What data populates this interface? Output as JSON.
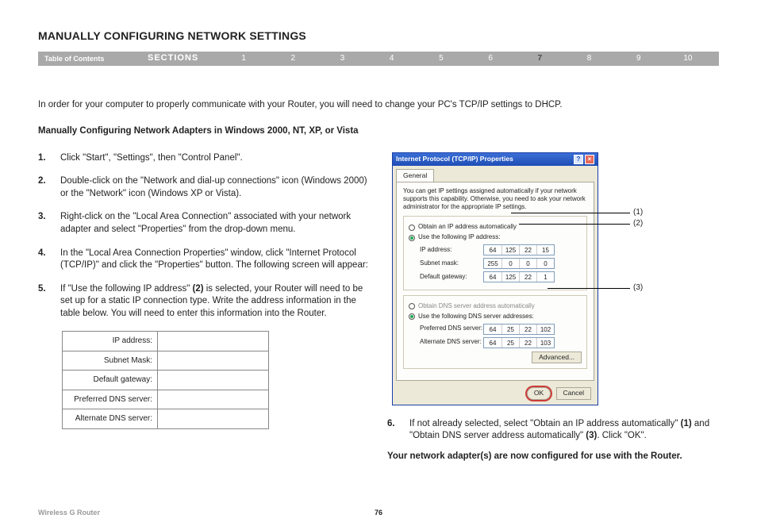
{
  "title": "MANUALLY CONFIGURING NETWORK SETTINGS",
  "nav": {
    "toc": "Table of Contents",
    "sections": "SECTIONS",
    "items": [
      "1",
      "2",
      "3",
      "4",
      "5",
      "6",
      "7",
      "8",
      "9",
      "10"
    ],
    "active": 6
  },
  "intro": "In order for your computer to properly communicate with your Router, you will need to change your PC's TCP/IP settings to DHCP.",
  "subhead": "Manually Configuring Network Adapters in Windows 2000, NT, XP, or Vista",
  "steps": {
    "s1": "Click \"Start\", \"Settings\", then \"Control Panel\".",
    "s2": "Double-click on the \"Network and dial-up connections\" icon (Windows 2000) or the \"Network\" icon (Windows XP or Vista).",
    "s3": "Right-click on the \"Local Area Connection\" associated with your network adapter and select \"Properties\" from the drop-down menu.",
    "s4": "In the \"Local Area Connection Properties\" window, click \"Internet Protocol (TCP/IP)\" and click the \"Properties\" button. The following screen will appear:",
    "s5a": "If \"Use the following IP address\" ",
    "s5b": "(2)",
    "s5c": " is selected, your Router will need to be set up for a static IP connection type. Write the address information in the table below. You will need to enter this information into the Router.",
    "s6a": "If not already selected, select \"Obtain an IP address automatically\" ",
    "s6b": "(1)",
    "s6c": " and \"Obtain DNS server address automatically\" ",
    "s6d": "(3)",
    "s6e": ". Click \"OK\"."
  },
  "blank_rows": [
    "IP address:",
    "Subnet Mask:",
    "Default gateway:",
    "Preferred DNS server:",
    "Alternate DNS server:"
  ],
  "dlg": {
    "title": "Internet Protocol (TCP/IP) Properties",
    "tab": "General",
    "desc": "You can get IP settings assigned automatically if your network supports this capability. Otherwise, you need to ask your network administrator for the appropriate IP settings.",
    "r1": "Obtain an IP address automatically",
    "r2": "Use the following IP address:",
    "f_ip": "IP address:",
    "v_ip": [
      "64",
      "125",
      "22",
      "15"
    ],
    "f_sm": "Subnet mask:",
    "v_sm": [
      "255",
      "0",
      "0",
      "0"
    ],
    "f_gw": "Default gateway:",
    "v_gw": [
      "64",
      "125",
      "22",
      "1"
    ],
    "r3": "Obtain DNS server address automatically",
    "r4": "Use the following DNS server addresses:",
    "f_p": "Preferred DNS server:",
    "v_p": [
      "64",
      "25",
      "22",
      "102"
    ],
    "f_a": "Alternate DNS server:",
    "v_a": [
      "64",
      "25",
      "22",
      "103"
    ],
    "adv": "Advanced...",
    "ok": "OK",
    "cancel": "Cancel"
  },
  "callouts": {
    "c1": "(1)",
    "c2": "(2)",
    "c3": "(3)"
  },
  "final": "Your network adapter(s) are now configured for use with the Router.",
  "footer": {
    "left": "Wireless G Router",
    "page": "76"
  }
}
